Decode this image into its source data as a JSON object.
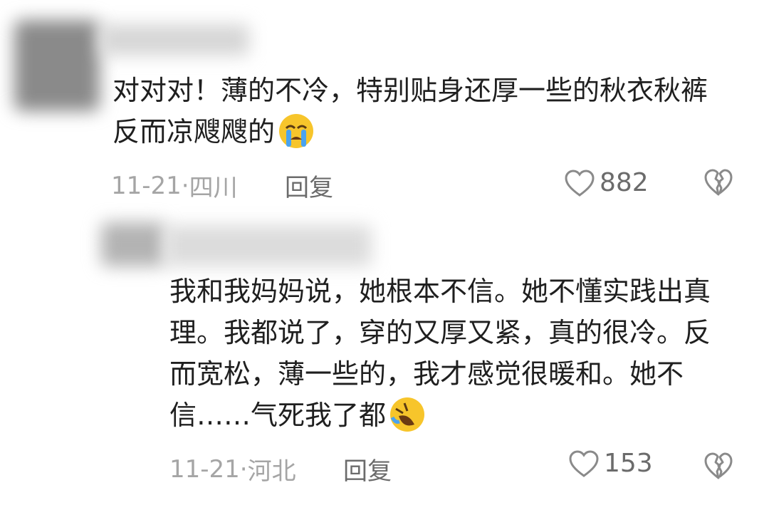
{
  "comments": [
    {
      "text": "对对对！薄的不冷，特别贴身还厚一些的秋衣秋裤反而凉飕飕的",
      "emoji": "loudly-crying-face-icon",
      "date": "11-21",
      "separator": "·",
      "location": "四川",
      "reply_label": "回复",
      "likes": "882"
    },
    {
      "text": "我和我妈妈说，她根本不信。她不懂实践出真理。我都说了，穿的又厚又紧，真的很冷。反而宽松，薄一些的，我才感觉很暖和。她不信……气死我了都",
      "emoji": "rolling-on-floor-laughing-icon",
      "date": "11-21",
      "separator": "·",
      "location": "河北",
      "reply_label": "回复",
      "likes": "153"
    }
  ],
  "colors": {
    "text": "#1f1f1f",
    "meta": "#a5a5a5",
    "reply": "#6b6b6b",
    "emoji": "#f7c52b"
  }
}
